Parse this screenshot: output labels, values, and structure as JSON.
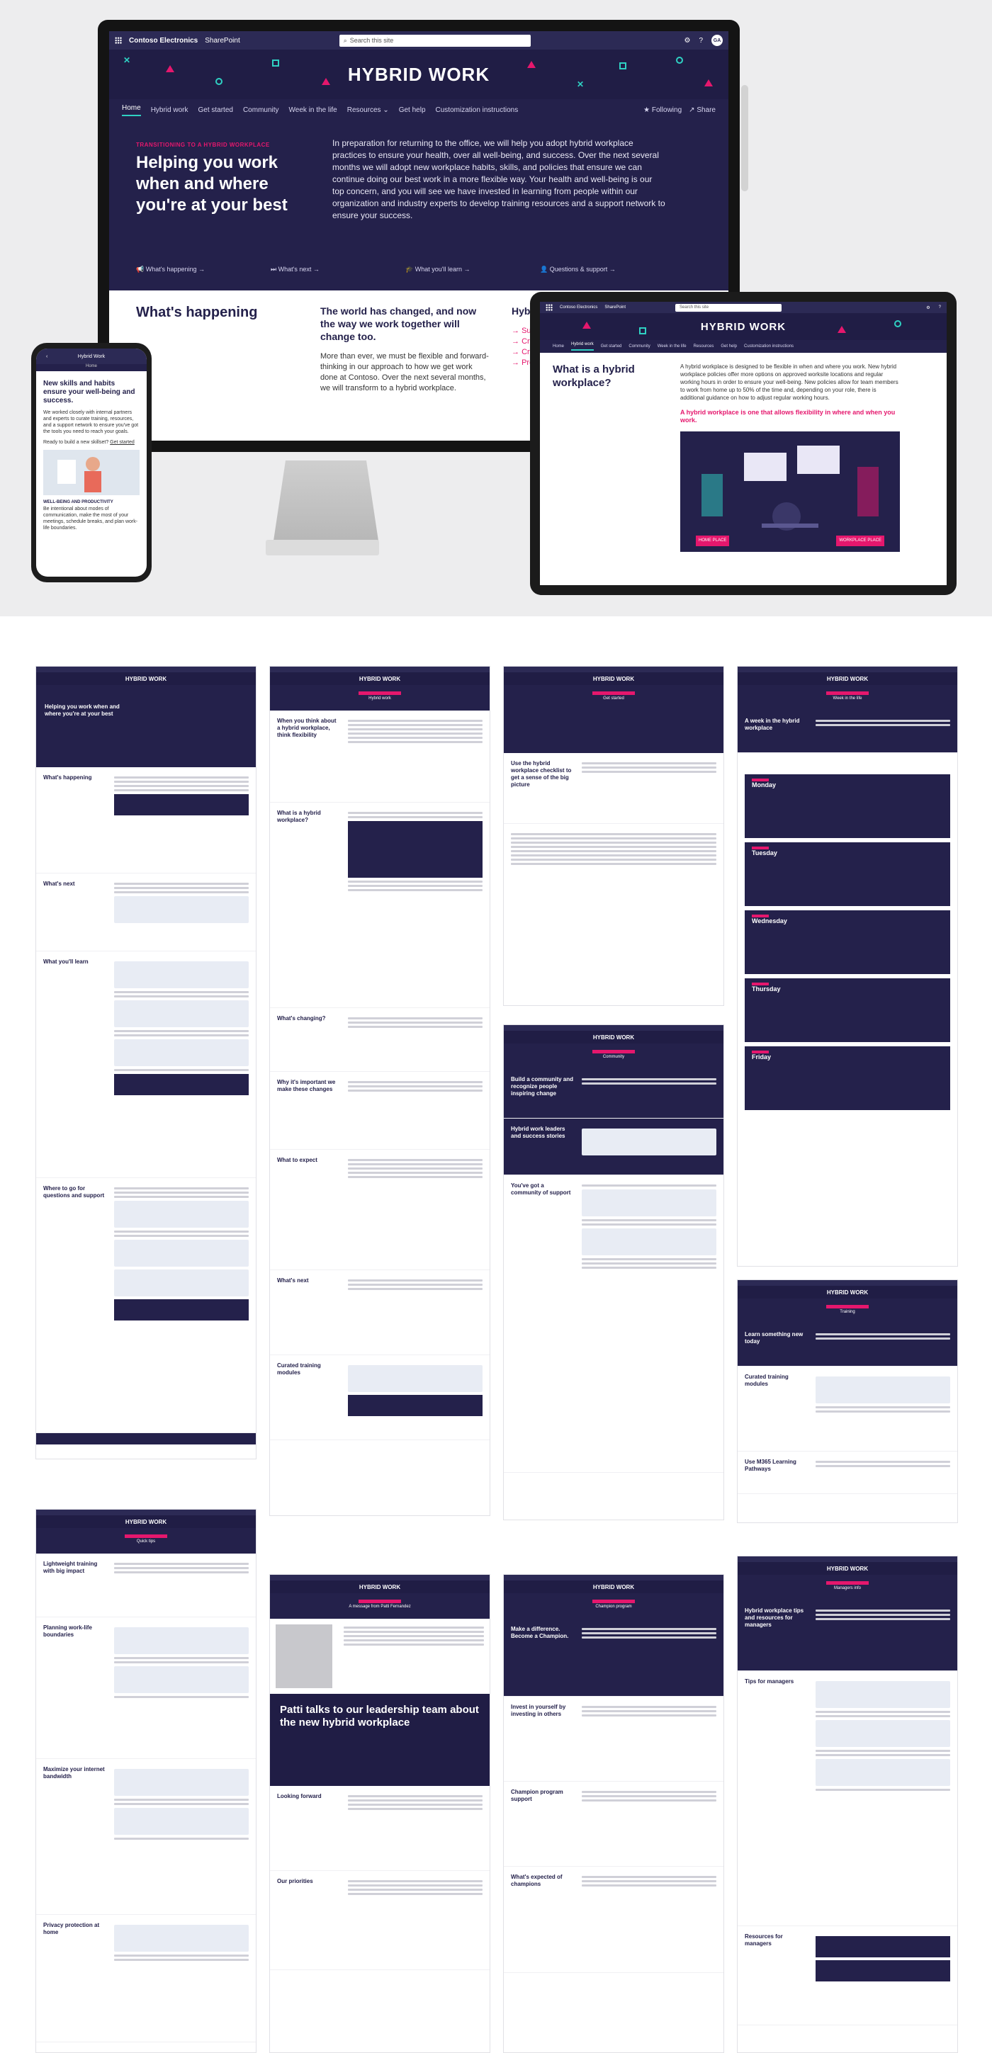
{
  "colors": {
    "brand_navy": "#24214b",
    "accent_pink": "#e5176d",
    "accent_teal": "#2fd1c3",
    "suite_bar": "#2c2a55"
  },
  "suite": {
    "org_name": "Contoso Electronics",
    "app": "SharePoint",
    "search_placeholder": "Search this site",
    "avatar_initials": "GA"
  },
  "banner_title": "HYBRID WORK",
  "nav": {
    "items": [
      "Home",
      "Hybrid work",
      "Get started",
      "Community",
      "Week in the life",
      "Resources",
      "Get help",
      "Customization instructions"
    ],
    "following": "Following",
    "share": "Share"
  },
  "home": {
    "eyebrow": "TRANSITIONING TO A HYBRID WORKPLACE",
    "heading": "Helping you work when and where you're at your best",
    "paragraph": "In preparation for returning to the office, we will help you adopt hybrid workplace practices to ensure your health, over all well-being, and success. Over the next several months we will adopt new workplace habits, skills, and policies that ensure we can continue doing our best work in a more flexible way. Your health and well-being is our top concern, and you will see we have invested in learning from people within our organization and industry experts to develop training resources and a support network to ensure your success.",
    "links": [
      "What's happening",
      "What's next",
      "What you'll learn",
      "Questions & support"
    ],
    "whats_happening": "What's happening",
    "change_heading": "The world has changed, and now the way we work together will change too.",
    "change_para": "More than ever, we must be flexible and forward-thinking in our approach to how we get work done at Contoso. Over the next several months, we will transform to a hybrid workplace.",
    "col3_heading": "Hyb",
    "col3_items": [
      "Sur",
      "Cre",
      "Cre",
      "Pro"
    ]
  },
  "tablet": {
    "heading": "What is a hybrid workplace?",
    "para": "A hybrid workplace is designed to be flexible in when and where you work. New hybrid workplace policies offer more options on approved worksite locations and regular working hours in order to ensure your well-being. New policies allow for team members to work from home up to 50% of the time and, depending on your role, there is additional guidance on how to adjust regular working hours.",
    "highlight": "A hybrid workplace is one that allows flexibility in where and when you work.",
    "label_left": "HOME PLACE",
    "label_right": "WORKPLACE PLACE"
  },
  "phone": {
    "title": "Hybrid Work",
    "crumb": "Home",
    "heading": "New skills and habits ensure your well-being and success.",
    "para": "We worked closely with internal partners and experts to curate training, resources, and a support network to ensure you've got the tools you need to reach your goals.",
    "cta_text": "Ready to build a new skillset?",
    "cta_link": "Get started",
    "label": "WELL-BEING AND PRODUCTIVITY",
    "label_para": "Be intentional about modes of communication, make the most of your meetings, schedule breaks, and plan work-life boundaries."
  },
  "thumbs": {
    "t1": {
      "sections": [
        "What's happening",
        "What's next",
        "What you'll learn",
        "Where to go for questions and support"
      ]
    },
    "t2": {
      "subtitle": "Hybrid work",
      "sections": [
        "When you think about a hybrid workplace, think flexibility",
        "What is a hybrid workplace?",
        "What's changing?",
        "Why it's important we make these changes",
        "What to expect",
        "What's next",
        "Curated training modules"
      ]
    },
    "t3": {
      "subtitle": "Get started",
      "sections": [
        "Use the hybrid workplace checklist to get a sense of the big picture"
      ]
    },
    "t4": {
      "subtitle": "Week in the life",
      "intro": "A week in the hybrid workplace",
      "days": [
        "Monday",
        "Tuesday",
        "Wednesday",
        "Thursday",
        "Friday"
      ]
    },
    "t5": {
      "subtitle": "Community",
      "sections": [
        "Build a community and recognize people inspiring change",
        "Hybrid work leaders and success stories",
        "You've got a community of support"
      ]
    },
    "t6": {
      "subtitle": "Training",
      "sections": [
        "Learn something new today",
        "Curated training modules",
        "Use M365 Learning Pathways"
      ]
    },
    "t7": {
      "subtitle": "Quick tips",
      "sections": [
        "Lightweight training with big impact",
        "Planning work-life boundaries",
        "Maximize your internet bandwidth",
        "Privacy protection at home"
      ]
    },
    "t8": {
      "subtitle": "A message from Patti Fernandez",
      "quote": "Patti talks to our leadership team about the new hybrid workplace",
      "sections": [
        "Looking forward",
        "Our priorities"
      ]
    },
    "t9": {
      "subtitle": "Champion program",
      "sections": [
        "Make a difference. Become a Champion.",
        "Invest in yourself by investing in others",
        "Champion program support",
        "What's expected of champions"
      ]
    },
    "t10": {
      "subtitle": "Managers info",
      "sections": [
        "Hybrid workplace tips and resources for managers",
        "Tips for managers",
        "Resources for managers"
      ]
    }
  }
}
